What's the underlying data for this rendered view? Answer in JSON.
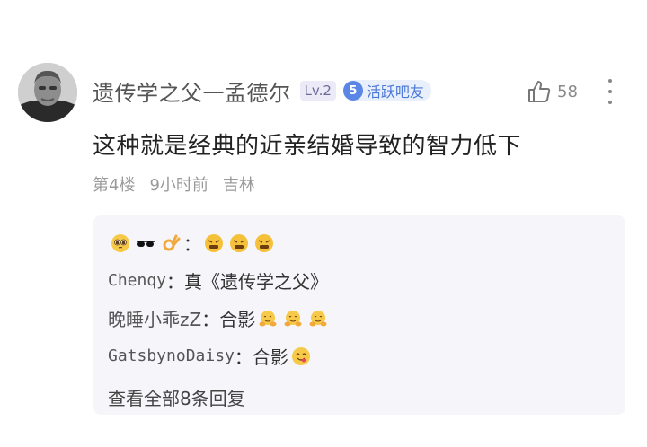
{
  "comment": {
    "username": "遗传学之父一孟德尔",
    "level_badge": "Lv.2",
    "active_badge": {
      "number": "5",
      "label": "活跃吧友"
    },
    "like_count": "58",
    "text": "这种就是经典的近亲结婚导致的智力低下",
    "floor": "第4楼",
    "time": "9小时前",
    "location": "吉林"
  },
  "replies": {
    "r1": {
      "sep": "："
    },
    "r2": {
      "name": "Chenqy",
      "text": "：真《遗传学之父》"
    },
    "r3": {
      "name": "晚睡小乖zZ",
      "text": "：合影"
    },
    "r4": {
      "name": "GatsbynoDaisy",
      "text": "：合影"
    },
    "view_all": "查看全部8条回复"
  },
  "icons": {
    "like": "thumbs-up-icon",
    "more": "more-vertical-icon",
    "emoji_pleading": "pleading-face-icon",
    "emoji_sunglasses": "sunglasses-icon",
    "emoji_ok": "ok-hand-icon",
    "emoji_frustrated": "frustrated-face-icon",
    "emoji_hug": "hug-face-icon",
    "emoji_yum": "yum-face-icon"
  },
  "colors": {
    "accent_blue": "#5a86e6",
    "level_text": "#6d6a9c",
    "reply_bg": "#f6f6fa"
  }
}
